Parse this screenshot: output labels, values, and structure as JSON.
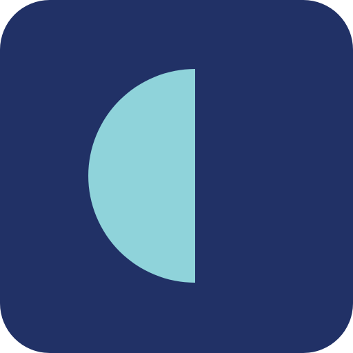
{
  "app_icon": {
    "icon_name": "half-moon-icon",
    "colors": {
      "background": "#213166",
      "shape": "#8FD3DA"
    }
  }
}
